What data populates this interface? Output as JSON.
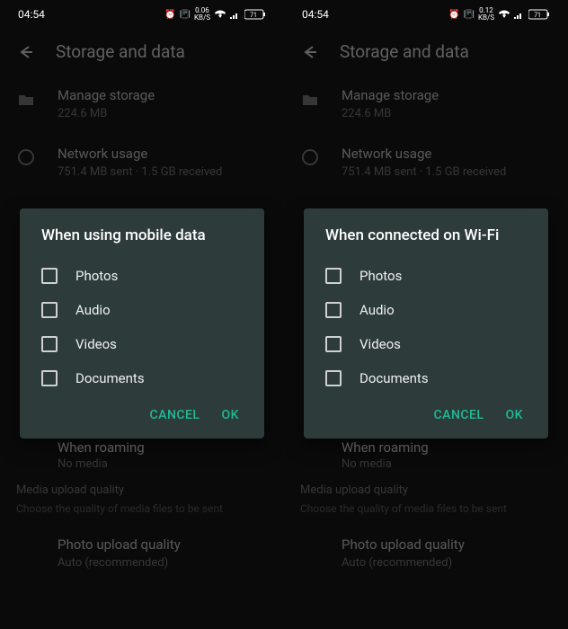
{
  "screens": [
    {
      "statusbar": {
        "time": "04:54",
        "speed": "0.06",
        "speed_unit": "KB/S",
        "battery": "71"
      },
      "appbar": {
        "title": "Storage and data"
      },
      "manage_storage": {
        "title": "Manage storage",
        "subtitle": "224.6 MB"
      },
      "network_usage": {
        "title": "Network usage",
        "subtitle": "751.4 MB sent · 1.5 GB received"
      },
      "dialog": {
        "title": "When using mobile data",
        "items": [
          "Photos",
          "Audio",
          "Videos",
          "Documents"
        ],
        "cancel": "CANCEL",
        "ok": "OK"
      },
      "roaming": {
        "title": "When roaming",
        "subtitle": "No media"
      },
      "media_quality": {
        "header": "Media upload quality",
        "sub": "Choose the quality of media files to be sent"
      },
      "photo_quality": {
        "title": "Photo upload quality",
        "subtitle": "Auto (recommended)"
      }
    },
    {
      "statusbar": {
        "time": "04:54",
        "speed": "0.12",
        "speed_unit": "KB/S",
        "battery": "71"
      },
      "appbar": {
        "title": "Storage and data"
      },
      "manage_storage": {
        "title": "Manage storage",
        "subtitle": "224.6 MB"
      },
      "network_usage": {
        "title": "Network usage",
        "subtitle": "751.4 MB sent · 1.5 GB received"
      },
      "dialog": {
        "title": "When connected on Wi-Fi",
        "items": [
          "Photos",
          "Audio",
          "Videos",
          "Documents"
        ],
        "cancel": "CANCEL",
        "ok": "OK"
      },
      "roaming": {
        "title": "When roaming",
        "subtitle": "No media"
      },
      "media_quality": {
        "header": "Media upload quality",
        "sub": "Choose the quality of media files to be sent"
      },
      "photo_quality": {
        "title": "Photo upload quality",
        "subtitle": "Auto (recommended)"
      }
    }
  ]
}
